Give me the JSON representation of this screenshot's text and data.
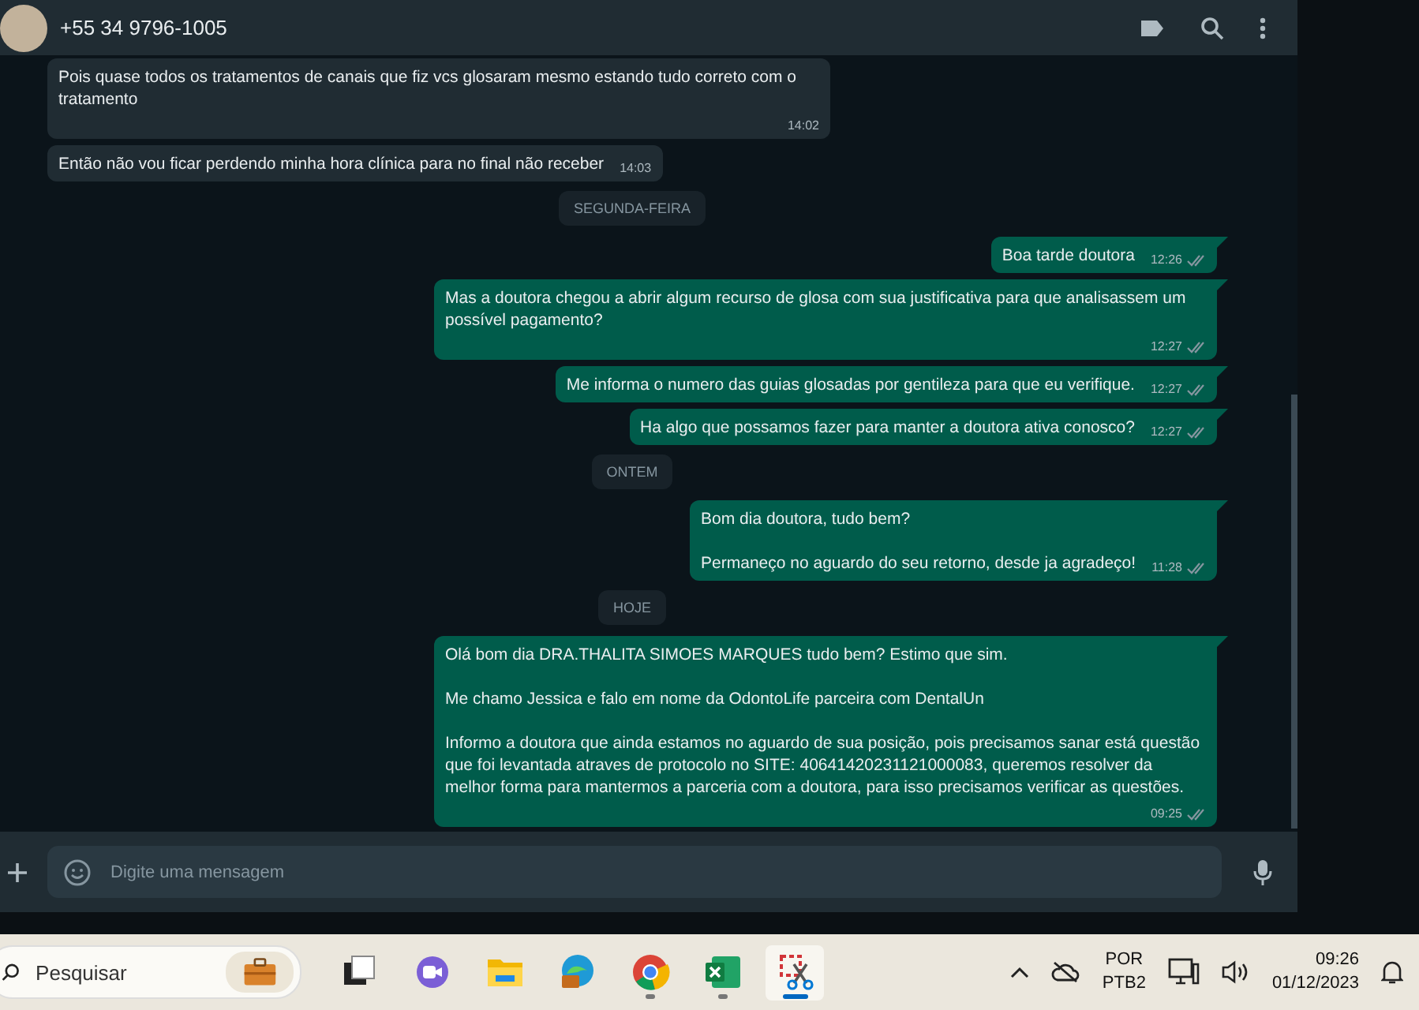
{
  "chat_header": {
    "title": "+55 34 9796-1005"
  },
  "messages": [
    {
      "kind": "incoming",
      "paragraphs": [
        "Pois quase todos os tratamentos de canais que fiz vcs glosaram mesmo estando tudo correto com o tratamento"
      ],
      "time": "14:02"
    },
    {
      "kind": "incoming",
      "paragraphs": [
        "Então não vou ficar perdendo minha hora clínica para no final não receber"
      ],
      "time": "14:03"
    },
    {
      "kind": "date",
      "label": "SEGUNDA-FEIRA"
    },
    {
      "kind": "outgoing",
      "paragraphs": [
        "Boa tarde doutora"
      ],
      "time": "12:26",
      "read": false
    },
    {
      "kind": "outgoing",
      "paragraphs": [
        "Mas a doutora chegou a abrir algum recurso de glosa com sua justificativa para que analisassem um possível pagamento?"
      ],
      "time": "12:27",
      "read": false
    },
    {
      "kind": "outgoing",
      "paragraphs": [
        "Me informa o numero das guias glosadas por gentileza para que eu verifique."
      ],
      "time": "12:27",
      "read": false
    },
    {
      "kind": "outgoing",
      "paragraphs": [
        "Ha algo que possamos fazer para manter a doutora ativa conosco?"
      ],
      "time": "12:27",
      "read": false
    },
    {
      "kind": "date",
      "label": "ONTEM"
    },
    {
      "kind": "outgoing",
      "paragraphs": [
        "Bom dia doutora, tudo bem?",
        "Permaneço no aguardo do seu retorno, desde ja agradeço!"
      ],
      "time": "11:28",
      "read": false
    },
    {
      "kind": "date",
      "label": "HOJE"
    },
    {
      "kind": "outgoing",
      "paragraphs": [
        "Olá bom dia DRA.THALITA SIMOES MARQUES tudo bem? Estimo que sim.",
        "Me chamo Jessica e falo em nome da OdontoLife parceira com DentalUn",
        "Informo a doutora que ainda estamos no aguardo de sua posição, pois precisamos sanar está questão que foi levantada atraves de protocolo no SITE: 40641420231121000083, queremos resolver da melhor forma para mantermos a parceria com a doutora, para isso precisamos verificar as questões."
      ],
      "time": "09:25",
      "read": false
    }
  ],
  "composer": {
    "placeholder": "Digite uma mensagem"
  },
  "taskbar": {
    "search": {
      "placeholder": "Pesquisar"
    },
    "apps": [
      {
        "kind": "taskview",
        "running": false,
        "selected": false
      },
      {
        "kind": "meet",
        "running": false,
        "selected": false
      },
      {
        "kind": "explorer",
        "running": false,
        "selected": false
      },
      {
        "kind": "edge",
        "running": false,
        "selected": false
      },
      {
        "kind": "chrome",
        "running": true,
        "selected": false
      },
      {
        "kind": "excel",
        "running": true,
        "selected": false
      },
      {
        "kind": "snip",
        "running": true,
        "selected": true
      }
    ],
    "language": [
      "POR",
      "PTB2"
    ],
    "time": "09:26",
    "date": "01/12/2023"
  }
}
